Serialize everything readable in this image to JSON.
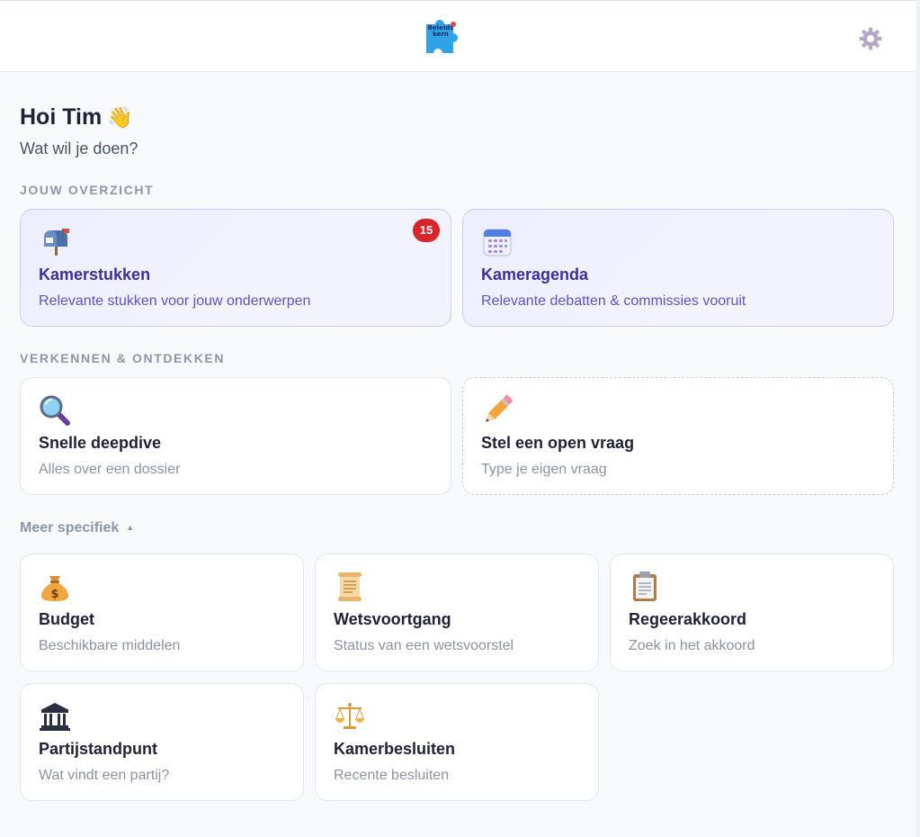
{
  "header": {
    "logo_text": "Beleids\nkern",
    "settings_icon": "gear-icon"
  },
  "greeting": {
    "title": "Hoi Tim",
    "emoji": "👋",
    "subtitle": "Wat wil je doen?"
  },
  "overview": {
    "label": "JOUW OVERZICHT",
    "cards": [
      {
        "title": "Kamerstukken",
        "desc": "Relevante stukken voor jouw onderwerpen",
        "badge": "15",
        "icon": "mailbox-icon"
      },
      {
        "title": "Kameragenda",
        "desc": "Relevante debatten & commissies vooruit",
        "icon": "calendar-icon"
      }
    ]
  },
  "explore": {
    "label": "VERKENNEN & ONTDEKKEN",
    "cards": [
      {
        "title": "Snelle deepdive",
        "desc": "Alles over een dossier",
        "icon": "magnifier-icon"
      },
      {
        "title": "Stel een open vraag",
        "desc": "Type je eigen vraag",
        "icon": "pencil-icon"
      }
    ]
  },
  "specific": {
    "toggle_label": "Meer specifiek",
    "toggle_arrow": "▲",
    "cards": [
      {
        "title": "Budget",
        "desc": "Beschikbare middelen",
        "icon": "money-bag-icon"
      },
      {
        "title": "Wetsvoortgang",
        "desc": "Status van een wetsvoorstel",
        "icon": "scroll-icon"
      },
      {
        "title": "Regeerakkoord",
        "desc": "Zoek in het akkoord",
        "icon": "clipboard-icon"
      },
      {
        "title": "Partijstandpunt",
        "desc": "Wat vindt een partij?",
        "icon": "classical-building-icon"
      },
      {
        "title": "Kamerbesluiten",
        "desc": "Recente besluiten",
        "icon": "balance-scale-icon"
      }
    ]
  },
  "colors": {
    "accent": "#3b2f9e",
    "accent_light": "#5d53c7",
    "badge": "#d7262b",
    "logo_blue": "#2fa3e6"
  }
}
